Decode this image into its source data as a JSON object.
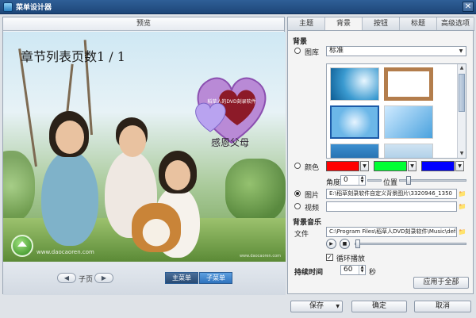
{
  "window": {
    "title": "菜单设计器",
    "close_glyph": "✕"
  },
  "preview": {
    "header": "预览",
    "page_title": "章节列表页数1 / 1",
    "hearts_caption_inner": "稻草人的DVD刻录软件",
    "hearts_label": "感恩父母",
    "website": "www.daocaoren.com",
    "watermark": "www.daocaoren.com",
    "footer": {
      "prev_glyph": "◀",
      "next_glyph": "▶",
      "subpage_label": "子页",
      "main_menu": "主菜单",
      "sub_menu": "子菜单"
    }
  },
  "tabs": [
    "主题",
    "背景",
    "按钮",
    "标题",
    "高级选项"
  ],
  "background": {
    "section_title": "背景",
    "library_label": "图库",
    "library_value": "标准",
    "color_label": "颜色",
    "colors": [
      "#ff0000",
      "#00ff33",
      "#0000ff"
    ],
    "angle_label": "角度",
    "angle_value": "0",
    "position_label": "位置",
    "picture_label": "图片",
    "picture_path": "E:\\稻草刻录软件自定义背景图片\\3320946_1350",
    "video_label": "视频",
    "video_path": "",
    "dropdown_arrow": "▼",
    "spin_up": "▲",
    "spin_down": "▼",
    "folder_glyph": "📁"
  },
  "music": {
    "section_title": "背景音乐",
    "file_label": "文件",
    "file_path": "C:\\Program Files\\稻草人DVD刻录软件\\Music\\defa",
    "play_glyph": "▶",
    "stop_glyph": "■",
    "loop_label": "循环播放",
    "loop_checked": "✓"
  },
  "duration": {
    "label": "持续时间",
    "value": "60",
    "unit": "秒"
  },
  "apply_all": "应用于全部",
  "bottom": {
    "save": "保存",
    "save_arrow": "▼",
    "ok": "确定",
    "cancel": "取消"
  }
}
